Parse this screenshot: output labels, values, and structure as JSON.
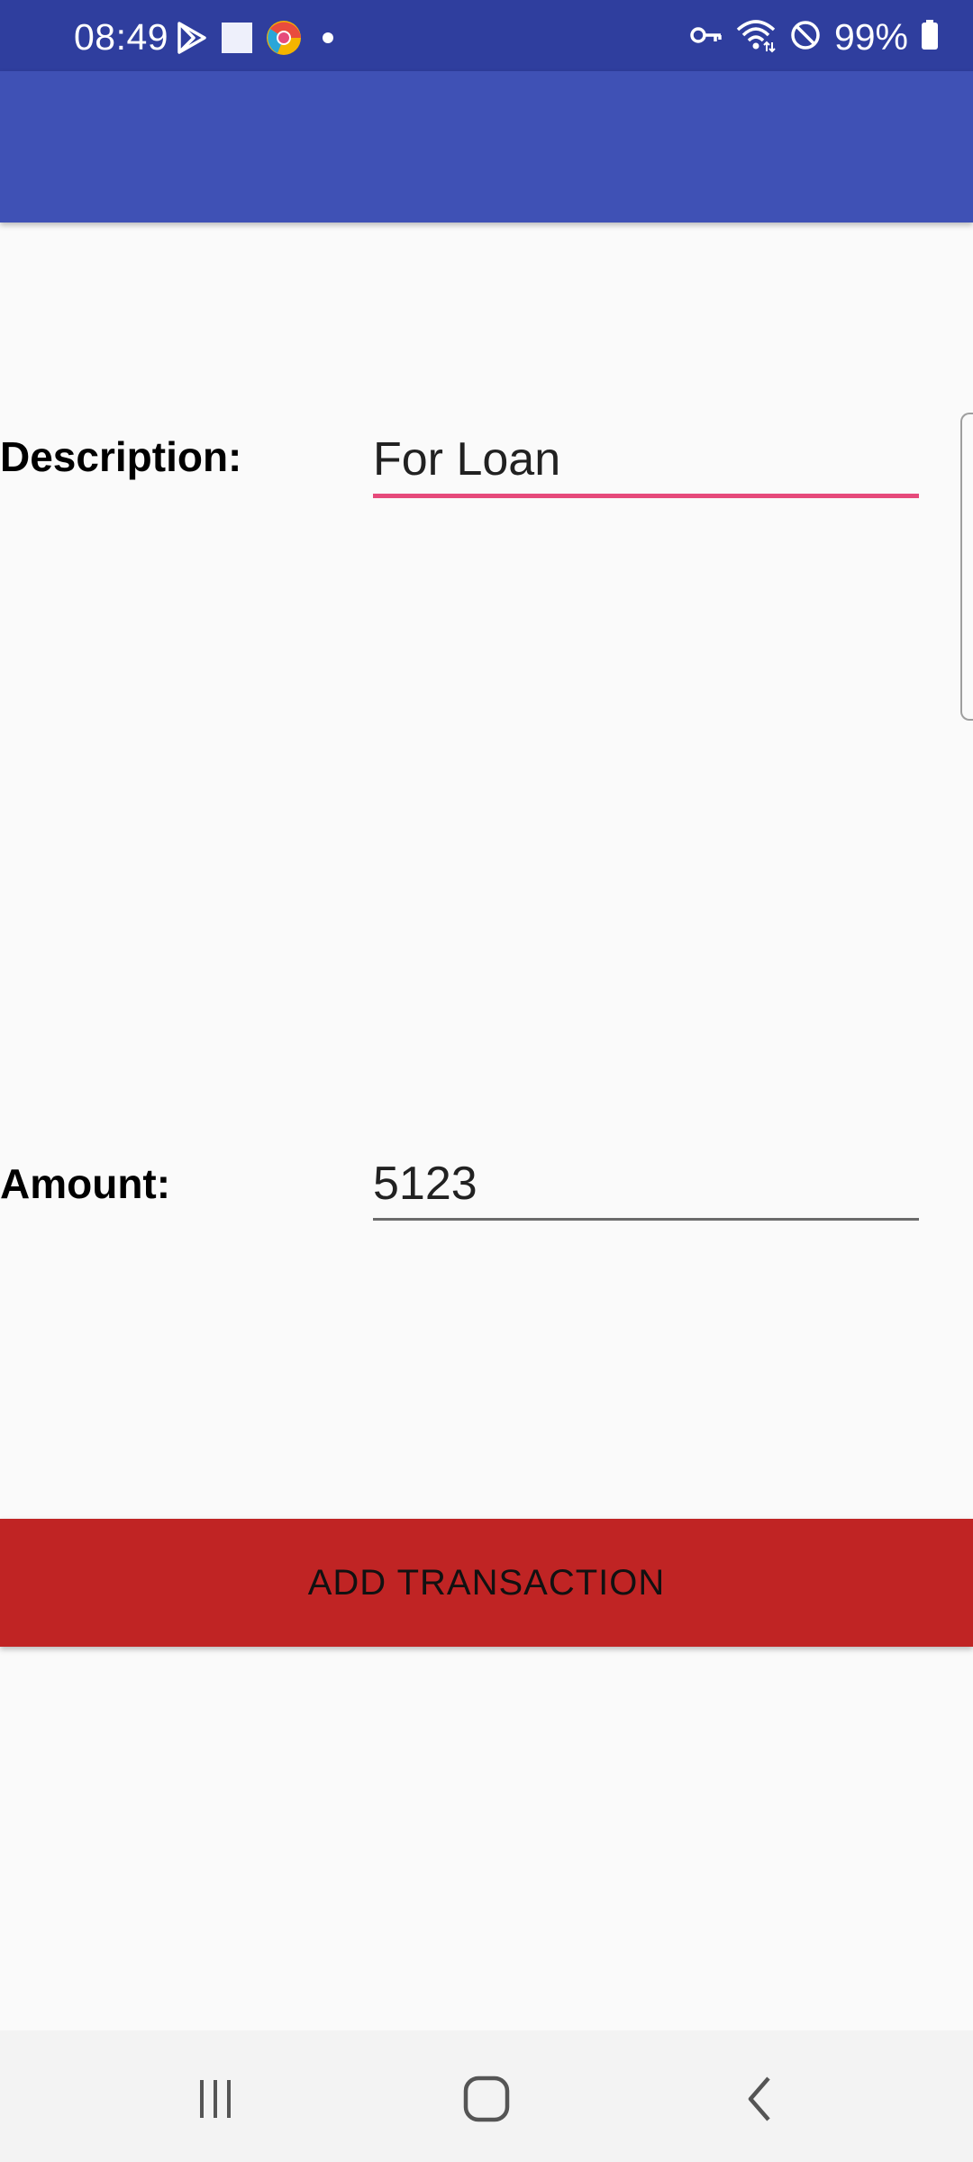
{
  "status_bar": {
    "time": "08:49",
    "battery": "99%",
    "icons": [
      "play-store-icon",
      "square-notification-icon",
      "chrome-icon",
      "dot-icon",
      "vpn-key-icon",
      "wifi-icon",
      "do-not-disturb-icon",
      "battery-icon"
    ]
  },
  "app_bar": {
    "title": ""
  },
  "form": {
    "description_label": "Description:",
    "description_value": "For Loan",
    "amount_label": "Amount:",
    "amount_value": "5123"
  },
  "actions": {
    "add_transaction_label": "ADD TRANSACTION"
  },
  "nav_bar": {
    "icons": [
      "recents-icon",
      "home-icon",
      "back-icon"
    ]
  },
  "colors": {
    "status_bar": "#2f3e9e",
    "app_bar": "#3f51b5",
    "focus_underline": "#e64a7b",
    "button": "#c02424",
    "background": "#fafafa"
  }
}
